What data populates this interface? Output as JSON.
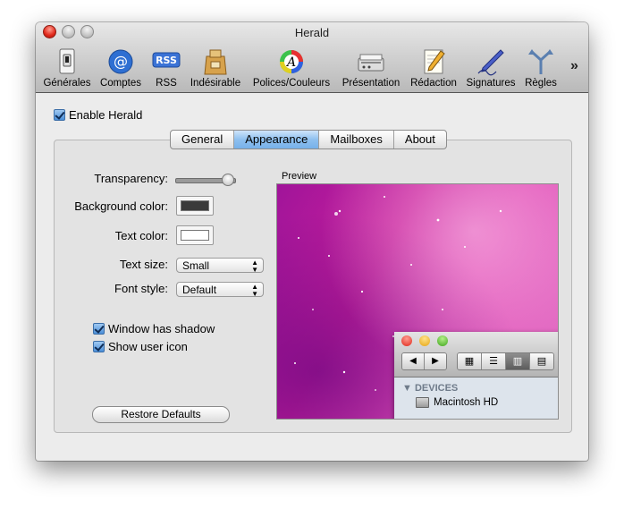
{
  "window": {
    "title": "Herald"
  },
  "toolbar": {
    "items": [
      {
        "label": "Générales",
        "icon": "general-switch-icon"
      },
      {
        "label": "Comptes",
        "icon": "at-sign-icon"
      },
      {
        "label": "RSS",
        "icon": "rss-icon"
      },
      {
        "label": "Indésirable",
        "icon": "junk-bag-icon"
      },
      {
        "label": "Polices/Couleurs",
        "icon": "fonts-colors-icon"
      },
      {
        "label": "Présentation",
        "icon": "presentation-icon"
      },
      {
        "label": "Rédaction",
        "icon": "compose-pencil-icon"
      },
      {
        "label": "Signatures",
        "icon": "signature-pen-icon"
      },
      {
        "label": "Règles",
        "icon": "rules-arrows-icon"
      }
    ],
    "overflow_label": "»"
  },
  "enable": {
    "label": "Enable Herald",
    "checked": true
  },
  "tabs": [
    {
      "label": "General",
      "selected": false
    },
    {
      "label": "Appearance",
      "selected": true
    },
    {
      "label": "Mailboxes",
      "selected": false
    },
    {
      "label": "About",
      "selected": false
    }
  ],
  "form": {
    "transparency_label": "Transparency:",
    "transparency_level": 0.85,
    "background_color_label": "Background color:",
    "background_color": "#3a3a3a",
    "text_color_label": "Text color:",
    "text_color": "#ffffff",
    "text_size_label": "Text size:",
    "text_size_value": "Small",
    "font_style_label": "Font style:",
    "font_style_value": "Default",
    "window_shadow_label": "Window has shadow",
    "window_shadow_checked": true,
    "show_user_icon_label": "Show user icon",
    "show_user_icon_checked": true,
    "restore_defaults_label": "Restore Defaults"
  },
  "preview": {
    "label": "Preview",
    "finder": {
      "section_header": "DEVICES",
      "device_name": "Macintosh HD",
      "nav_back": "◀",
      "nav_forward": "▶"
    }
  },
  "colors": {
    "accent": "#77b1ea",
    "wallpaper": "#c8209c"
  }
}
